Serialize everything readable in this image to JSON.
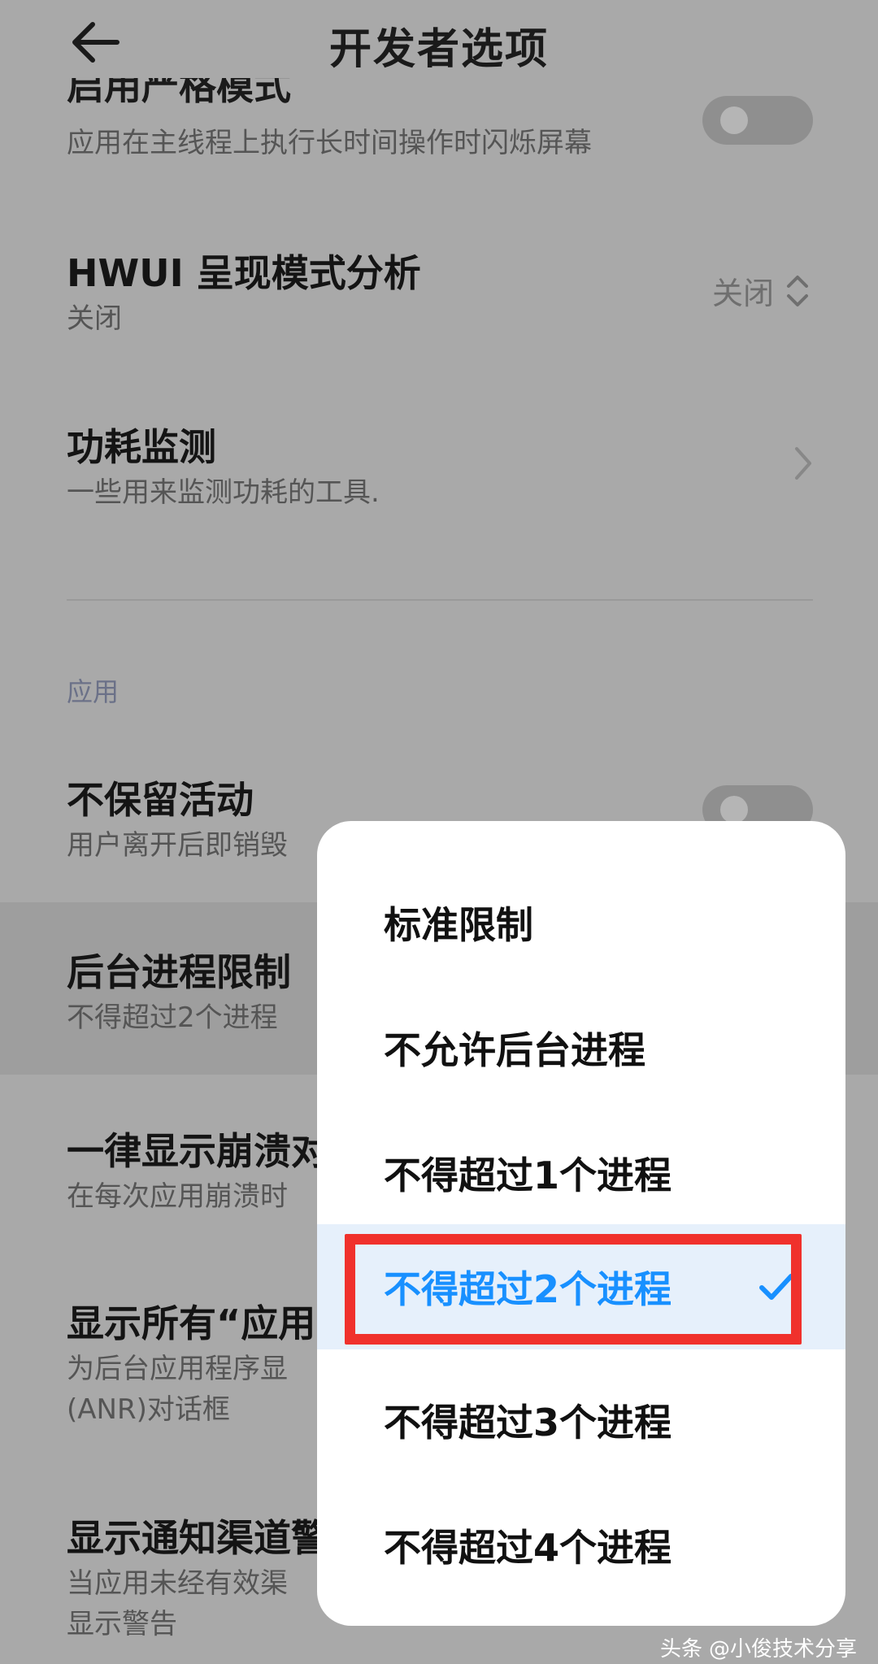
{
  "header": {
    "title": "开发者选项"
  },
  "rows": {
    "strict_mode": {
      "title_partial": "启用严格模式",
      "subtitle": "应用在主线程上执行长时间操作时闪烁屏幕"
    },
    "hwui": {
      "title": "HWUI 呈现模式分析",
      "subtitle": "关闭",
      "value": "关闭"
    },
    "power": {
      "title": "功耗监测",
      "subtitle": "一些用来监测功耗的工具."
    },
    "section_label": "应用",
    "dont_keep": {
      "title": "不保留活动",
      "subtitle": "用户离开后即销毁"
    },
    "bg_limit": {
      "title": "后台进程限制",
      "subtitle": "不得超过2个进程"
    },
    "crash": {
      "title": "一律显示崩溃对",
      "subtitle": "在每次应用崩溃时"
    },
    "anr": {
      "title": "显示所有“应用",
      "subtitle1": "为后台应用程序显",
      "subtitle2": "(ANR)对话框"
    },
    "channel": {
      "title": "显示通知渠道警",
      "subtitle1": "当应用未经有效渠",
      "subtitle2": "显示警告"
    }
  },
  "dialog": {
    "options": [
      "标准限制",
      "不允许后台进程",
      "不得超过1个进程",
      "不得超过2个进程",
      "不得超过3个进程",
      "不得超过4个进程"
    ],
    "selected_index": 3
  },
  "watermark": {
    "source": "头条",
    "author": "@小俊技术分享"
  },
  "colors": {
    "accent": "#1890ff",
    "annotation_red": "#f0312c",
    "overlay_bg": "#a9a9a9"
  },
  "icons": {
    "back": "arrow-left-icon",
    "spinner": "chevron-up-down-icon",
    "chevron": "chevron-right-icon",
    "check": "check-icon"
  }
}
